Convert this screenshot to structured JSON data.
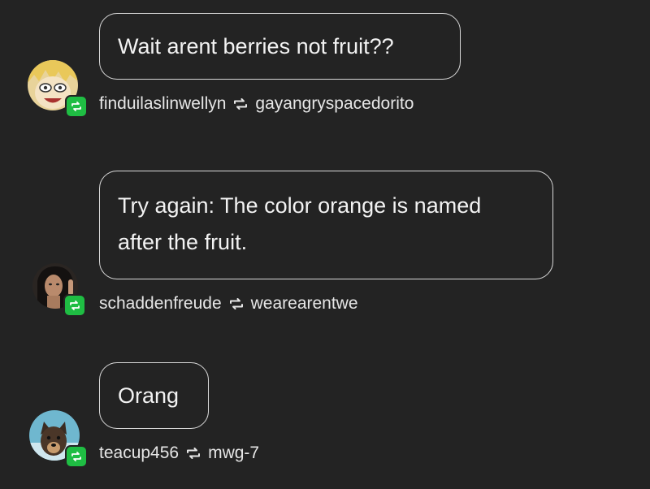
{
  "thread": [
    {
      "message_lines": [
        "Wait arent berries not fruit??"
      ],
      "author": "finduilaslinwellyn",
      "reblogged_from": "gayangryspacedorito",
      "avatar_icon": "anime-blonde-face-avatar",
      "badge_icon": "reblog-icon",
      "badge_color": "#1fbd43"
    },
    {
      "message_lines": [
        "Try again: The color orange is named",
        "after the fruit."
      ],
      "author": "schaddenfreude",
      "reblogged_from": "wearearentwe",
      "avatar_icon": "dark-haired-person-avatar",
      "badge_icon": "reblog-icon",
      "badge_color": "#1fbd43"
    },
    {
      "message_lines": [
        "Orang"
      ],
      "author": "teacup456",
      "reblogged_from": "mwg-7",
      "avatar_icon": "dog-photo-avatar",
      "badge_icon": "reblog-icon",
      "badge_color": "#1fbd43"
    }
  ],
  "colors": {
    "background": "#232323",
    "bubble_border": "#d9d9d9",
    "text": "#f2f2f2",
    "reblog_green": "#1fbd43"
  }
}
